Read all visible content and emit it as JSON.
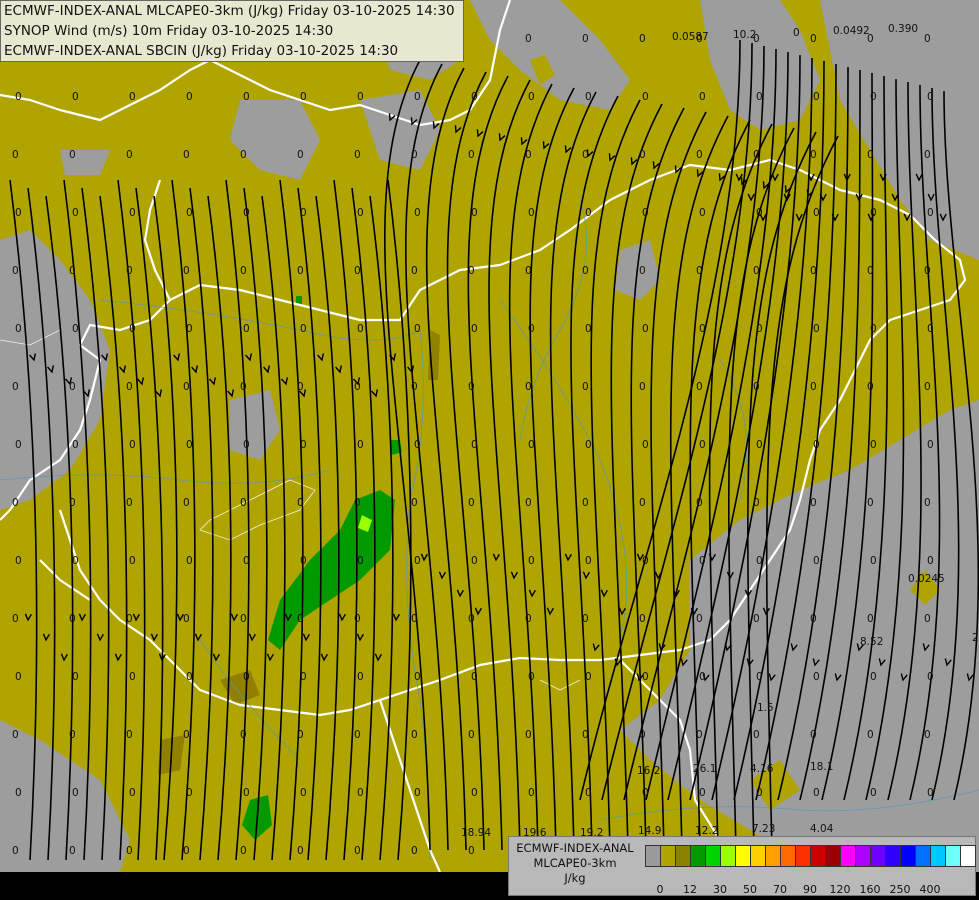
{
  "title_lines": [
    "ECMWF-INDEX-ANAL MLCAPE0-3km (J/kg) Friday 03-10-2025 14:30",
    "SYNOP Wind (m/s) 10m Friday 03-10-2025 14:30",
    "ECMWF-INDEX-ANAL SBCIN (J/kg) Friday 03-10-2025 14:30"
  ],
  "legend": {
    "title_lines": [
      "ECMWF-INDEX-ANAL",
      "MLCAPE0-3km",
      "J/kg"
    ],
    "colors": [
      "#9a9a9a",
      "#b0a400",
      "#8a8200",
      "#009a00",
      "#00d400",
      "#9aff00",
      "#ffff00",
      "#ffd000",
      "#ffa000",
      "#ff6a00",
      "#ff3000",
      "#cc0000",
      "#990000",
      "#ff00ff",
      "#b000ff",
      "#7000ff",
      "#3000ff",
      "#0000ff",
      "#0070ff",
      "#00c8ff",
      "#70ffff",
      "#ffffff"
    ],
    "ticks": [
      "0",
      "12",
      "30",
      "50",
      "70",
      "90",
      "120",
      "160",
      "250",
      "400"
    ]
  },
  "cin_labels": [
    {
      "text": "0.0587"
    },
    {
      "text": "10.2"
    },
    {
      "text": "0"
    },
    {
      "text": "0.0492"
    },
    {
      "text": "0.390"
    },
    {
      "text": "0.0245"
    },
    {
      "text": "8.52"
    },
    {
      "text": "2"
    },
    {
      "text": "1.5"
    },
    {
      "text": "4.16"
    },
    {
      "text": "18.1"
    },
    {
      "text": "16.2"
    },
    {
      "text": "26.1"
    },
    {
      "text": "18.94"
    },
    {
      "text": "19.6"
    },
    {
      "text": "19.2"
    },
    {
      "text": "14.9"
    },
    {
      "text": "12.2"
    },
    {
      "text": "7.23"
    },
    {
      "text": "4.04"
    }
  ],
  "zero_label": "0"
}
